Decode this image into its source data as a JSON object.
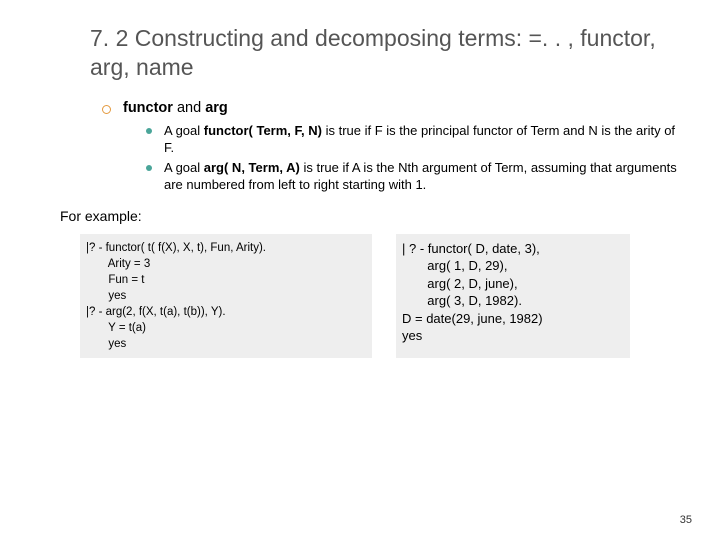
{
  "title": "7. 2 Constructing and decomposing terms: =. . , functor, arg, name",
  "section": {
    "prefix": "functor",
    "mid": " and ",
    "suffix": "arg"
  },
  "bullets": [
    {
      "pre": "A goal ",
      "strong": "functor( Term, F, N)",
      "post": " is true if F is the principal functor of Term and N is the arity of F."
    },
    {
      "pre": "A goal ",
      "strong": "arg( N, Term, A)",
      "post": " is true if A is the Nth argument of Term, assuming that arguments are numbered from left to right starting with 1."
    }
  ],
  "for_example": "For example:",
  "example_left": "|? - functor( t( f(X), X, t), Fun, Arity).\n       Arity = 3\n       Fun = t\n       yes\n|? - arg(2, f(X, t(a), t(b)), Y).\n       Y = t(a)\n       yes",
  "example_right": "| ? - functor( D, date, 3),\n       arg( 1, D, 29),\n       arg( 2, D, june),\n       arg( 3, D, 1982).\nD = date(29, june, 1982)\nyes",
  "page_number": "35"
}
